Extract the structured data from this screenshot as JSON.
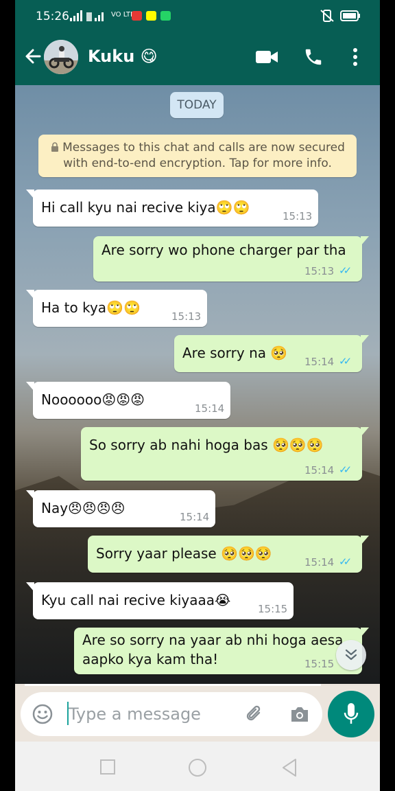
{
  "status": {
    "time": "15:26",
    "carrier": "VO LTE",
    "network": "4G"
  },
  "header": {
    "contact_name": "Kuku 😋"
  },
  "chat": {
    "date_label": "TODAY",
    "encryption_notice": "Messages to this chat and calls are now secured with end-to-end encryption. Tap for more info.",
    "messages": [
      {
        "direction": "in",
        "text": "Hi call kyu nai recive kiya🙄🙄",
        "time": "15:13"
      },
      {
        "direction": "out",
        "text": "Are sorry wo phone charger par tha",
        "time": "15:13",
        "read": true
      },
      {
        "direction": "in",
        "text": "Ha to kya🙄🙄",
        "time": "15:13"
      },
      {
        "direction": "out",
        "text": "Are sorry na 🥺",
        "time": "15:14",
        "read": true
      },
      {
        "direction": "in",
        "text": "Noooooo😡😡😡",
        "time": "15:14"
      },
      {
        "direction": "out",
        "text": "So sorry ab nahi hoga bas 🥺🥺🥺",
        "time": "15:14",
        "read": true
      },
      {
        "direction": "in",
        "text": "Nay😠😠😠😠",
        "time": "15:14"
      },
      {
        "direction": "out",
        "text": "Sorry yaar please 🥺🥺🥺",
        "time": "15:14",
        "read": true
      },
      {
        "direction": "in",
        "text": "Kyu call nai recive kiyaaa😭",
        "time": "15:15"
      },
      {
        "direction": "out",
        "text": "Are so sorry na yaar ab nhi hoga aesa aapko kya kam tha!",
        "line1": "Are so sorry na yaar ab nhi hoga aesa",
        "line2": "aapko kya kam tha!",
        "time": "15:15"
      }
    ]
  },
  "composer": {
    "placeholder": "Type a message"
  },
  "colors": {
    "header": "#075e54",
    "outgoing_bubble": "#dcf8c6",
    "incoming_bubble": "#ffffff",
    "read_ticks": "#34b7f1",
    "mic_button": "#00897b"
  },
  "icons": [
    "back-arrow-icon",
    "video-call-icon",
    "voice-call-icon",
    "more-options-icon",
    "lock-icon",
    "emoji-icon",
    "attach-icon",
    "camera-icon",
    "mic-icon",
    "scroll-down-icon"
  ]
}
